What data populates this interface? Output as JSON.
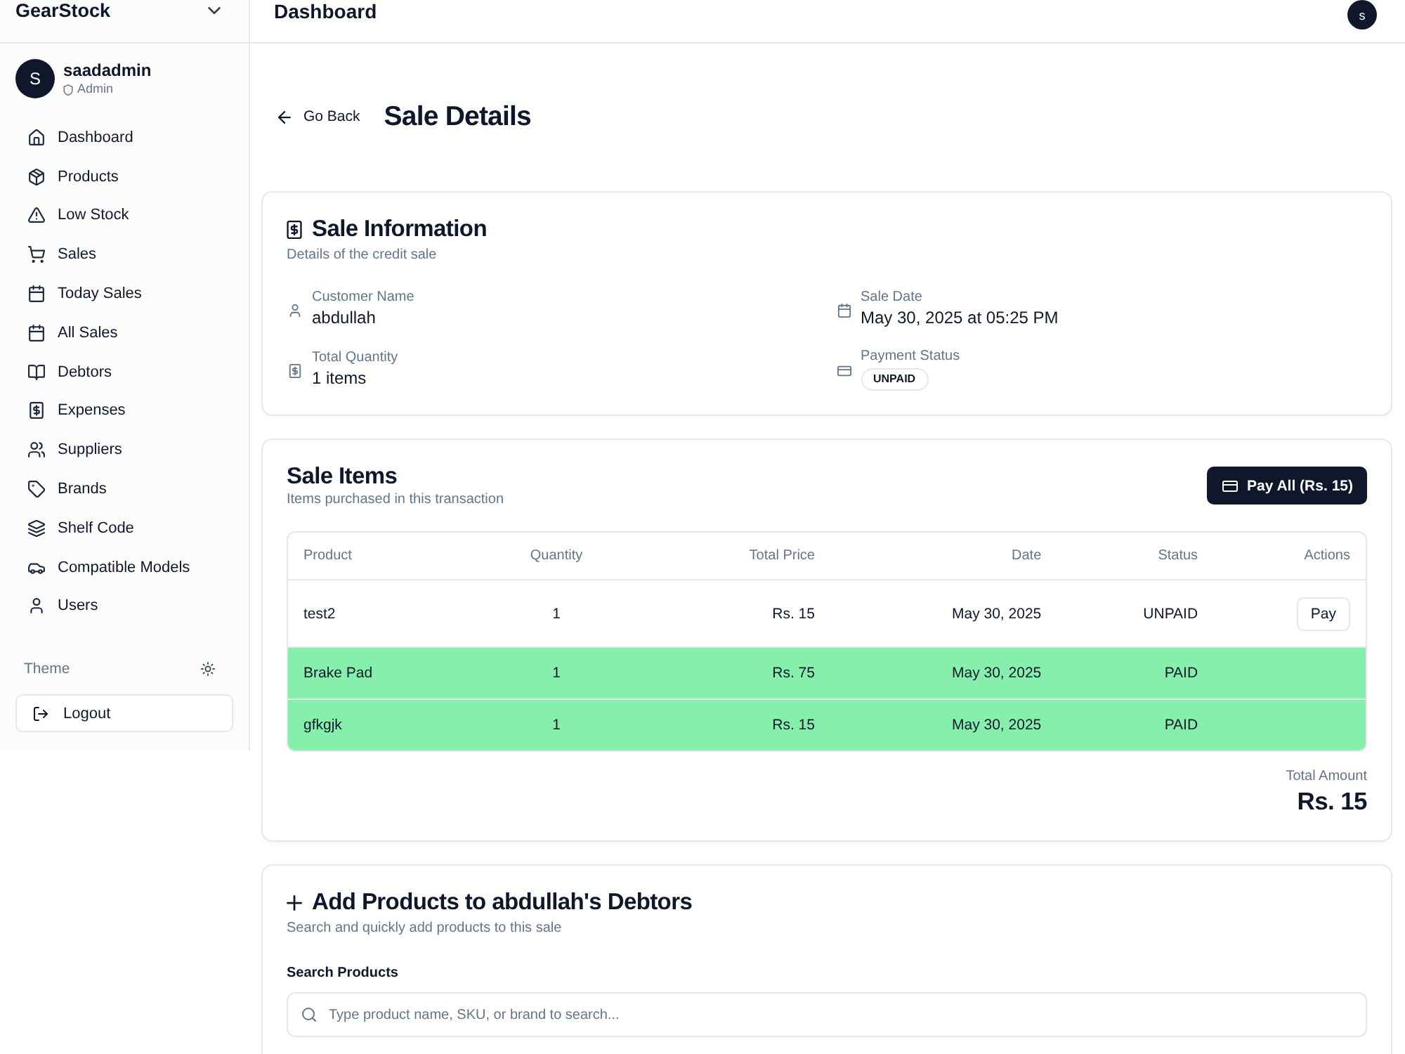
{
  "sidebar": {
    "brand": "GearStock",
    "user": {
      "initial": "S",
      "name": "saadadmin",
      "role": "Admin"
    },
    "items": [
      {
        "label": "Dashboard",
        "selected": false
      },
      {
        "label": "Products",
        "selected": false
      },
      {
        "label": "Low Stock",
        "selected": false
      },
      {
        "label": "Sales",
        "selected": false
      },
      {
        "label": "Today Sales",
        "selected": false
      },
      {
        "label": "All Sales",
        "selected": false
      },
      {
        "label": "Debtors",
        "selected": false
      },
      {
        "label": "Expenses",
        "selected": false
      },
      {
        "label": "Suppliers",
        "selected": false
      },
      {
        "label": "Brands",
        "selected": false
      },
      {
        "label": "Shelf Code",
        "selected": false
      },
      {
        "label": "Compatible Models",
        "selected": false
      },
      {
        "label": "Users",
        "selected": false
      }
    ],
    "theme_label": "Theme",
    "logout": "Logout"
  },
  "header": {
    "title": "Dashboard",
    "avatar_initial": "s"
  },
  "page": {
    "back": "Go Back",
    "title": "Sale Details"
  },
  "sale_info": {
    "title": "Sale Information",
    "subtitle": "Details of the credit sale",
    "fields": [
      {
        "kind": "text",
        "label": "Customer Name",
        "value": "abdullah"
      },
      {
        "kind": "text",
        "label": "Sale Date",
        "value": "May 30, 2025 at 05:25 PM"
      },
      {
        "kind": "text",
        "label": "Total Quantity",
        "value": "1 items"
      },
      {
        "kind": "badge",
        "label": "Payment Status",
        "value": "UNPAID"
      }
    ]
  },
  "sale_items": {
    "title": "Sale Items",
    "subtitle": "Items purchased in this transaction",
    "pay_all_button": "Pay All (Rs. 15)",
    "table": {
      "columns": [
        "Product",
        "Quantity",
        "Total Price",
        "Date",
        "Status",
        "Actions"
      ],
      "rows": [
        {
          "cells": [
            "test2",
            "1",
            "Rs. 15",
            "May 30, 2025",
            "UNPAID"
          ],
          "paid": false,
          "action": "Pay"
        },
        {
          "cells": [
            "Brake Pad",
            "1",
            "Rs. 75",
            "May 30, 2025",
            "PAID"
          ],
          "paid": true
        },
        {
          "cells": [
            "gfkgjk",
            "1",
            "Rs. 15",
            "May 30, 2025",
            "PAID"
          ],
          "paid": true
        }
      ]
    },
    "total_label": "Total Amount",
    "total_value": "Rs. 15"
  },
  "add_products": {
    "title": "Add Products to abdullah's Debtors",
    "subtitle": "Search and quickly add products to this sale",
    "search": {
      "label": "Search Products",
      "placeholder": "Type product name, SKU, or brand to search..."
    }
  }
}
